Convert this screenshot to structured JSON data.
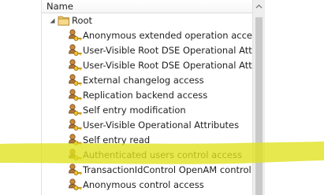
{
  "header": {
    "name_column": "Name"
  },
  "tree": {
    "root": {
      "label": "Root",
      "icon": "folder-icon",
      "expanded": true
    },
    "items": [
      {
        "label": "Anonymous extended operation access",
        "icon": "aci-key-user-icon"
      },
      {
        "label": "User-Visible Root DSE Operational Attributes",
        "icon": "aci-key-user-icon"
      },
      {
        "label": "User-Visible Root DSE Operational Attributes",
        "icon": "aci-key-user-icon"
      },
      {
        "label": "External changelog access",
        "icon": "aci-key-user-icon"
      },
      {
        "label": "Replication backend access",
        "icon": "aci-key-user-icon"
      },
      {
        "label": "Self entry modification",
        "icon": "aci-key-user-icon"
      },
      {
        "label": "User-Visible Operational Attributes",
        "icon": "aci-key-user-icon"
      },
      {
        "label": "Self entry read",
        "icon": "aci-key-user-icon"
      },
      {
        "label": "Authenticated users control access",
        "icon": "aci-key-user-icon"
      },
      {
        "label": "TransactionIdControl OpenAM control",
        "icon": "aci-key-user-icon"
      },
      {
        "label": "Anonymous control access",
        "icon": "aci-key-user-icon"
      }
    ]
  },
  "highlight": {
    "item": "Authenticated users control access",
    "color": "#e8ea1e"
  },
  "colors": {
    "folder": "#e9b64a",
    "key": "#d7a21c",
    "user": "#8a5a2a"
  }
}
